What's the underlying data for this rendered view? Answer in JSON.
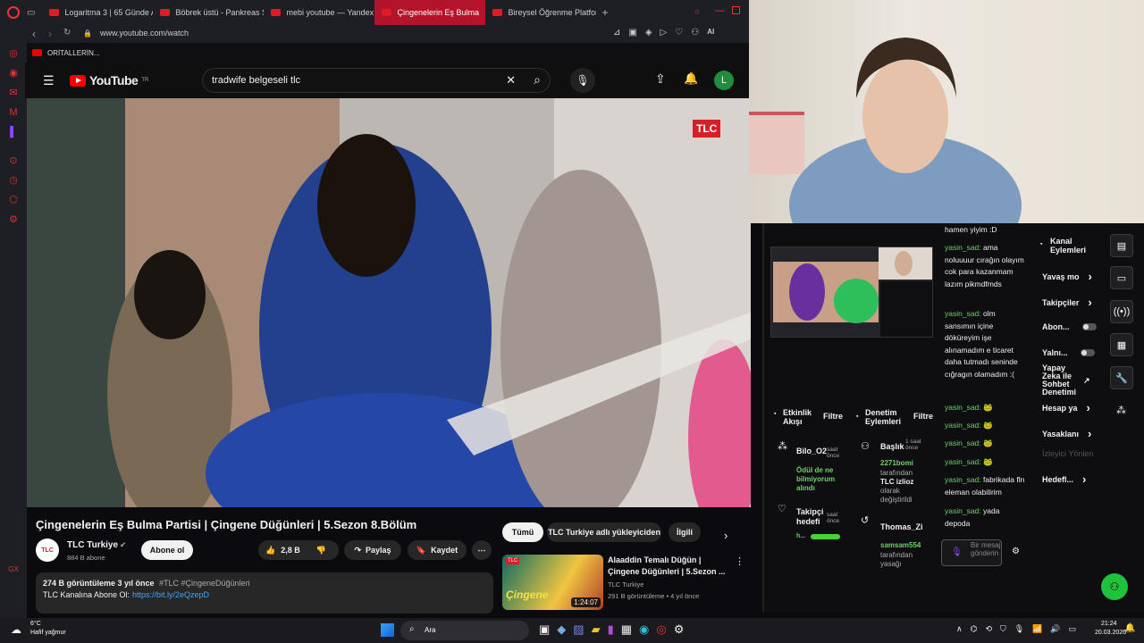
{
  "browser": {
    "tabs": [
      {
        "label": "Logaritma 3 | 65 Günde A",
        "active": false
      },
      {
        "label": "Böbrek üstü - Pankreas S",
        "active": false
      },
      {
        "label": "mebi youtube — Yandex",
        "active": false
      },
      {
        "label": "Çingenelerin Eş Bulma",
        "active": true
      },
      {
        "label": "Bireysel Öğrenme Platform",
        "active": false
      }
    ],
    "url": "www.youtube.com/watch",
    "bookmark": "ORİTALLERİN...",
    "ai_label": "AI"
  },
  "youtube": {
    "country": "TR",
    "logo_text": "YouTube",
    "search_value": "tradwife belgeseli tlc",
    "avatar_letter": "L",
    "video_watermark": "TLC",
    "video_title": "Çingenelerin Eş Bulma Partisi | Çingene Düğünleri | 5.Sezon 8.Bölüm",
    "channel": {
      "name": "TLC Turkiye",
      "subs": "884 B abone",
      "subscribe": "Abone ol",
      "logo": "TLC"
    },
    "likes": "2,8 B",
    "share": "Paylaş",
    "save": "Kaydet",
    "views": "274 B görüntüleme  3 yıl önce",
    "hashtags": "#TLC #ÇingeneDüğünleri",
    "desc_prefix": "TLC Kanalına Abone Ol:",
    "desc_link": "https://bit.ly/2eQzepD",
    "chips": [
      "Tümü",
      "TLC Turkiye adlı yükleyiciden",
      "İlgili"
    ],
    "rec": {
      "title_line1": "Alaaddin Temalı Düğün |",
      "title_line2": "Çingene Düğünleri | 5.Sezon ...",
      "channel": "TLC Turkiye",
      "meta": "291 B görüntüleme  •  4 yıl önce",
      "duration": "1:24:07",
      "thumb_text": "Çingene"
    }
  },
  "stream": {
    "activity_title": "Etkinlik Akışı",
    "filter": "Filtre",
    "activity": [
      {
        "name": "Bilo_O2",
        "time": "saat önce",
        "detail": "Ödül de ne bilmiyorum alındı"
      },
      {
        "name": "Takipçi hedefi",
        "time": "saat önce",
        "detail": "h..."
      }
    ],
    "mod_title": "Denetim Eylemleri",
    "mod_filter": "Filtre",
    "mod": [
      {
        "name": "Başlık",
        "time": "1 saat önce",
        "user": "2271bomi",
        "detail1": "tarafından",
        "detail2": "TLC izlioz",
        "detail3": "olarak değiştirildi"
      },
      {
        "name": "Thomas_Zi",
        "user": "samsam554",
        "detail1": "tarafından",
        "detail2": "yasağı"
      }
    ],
    "chat": [
      {
        "user": "",
        "text": "hamen yiyim :D"
      },
      {
        "user": "yasin_sad:",
        "text": " ama noluuuur cırağın olayım cok para kazanmam lazım pikmdfmds"
      },
      {
        "user": "yasin_sad:",
        "text": " olm sansımın içine döküreyim işe alınamadım e ticaret daha tutmadı seninde cığragın olamadım :("
      },
      {
        "user": "yasin_sad:",
        "text": " 🐸"
      },
      {
        "user": "yasin_sad:",
        "text": " 🐸"
      },
      {
        "user": "yasin_sad:",
        "text": " 🐸"
      },
      {
        "user": "yasin_sad:",
        "text": " 🐸"
      },
      {
        "user": "yasin_sad:",
        "text": " fabrikada fln eleman olabilirim"
      },
      {
        "user": "yasin_sad:",
        "text": " yada depoda"
      }
    ],
    "chat_placeholder": "Bir mesaj gönderin",
    "channel_actions_title": "Kanal Eylemleri",
    "channel_actions": [
      {
        "label": "Yavaş mo",
        "kind": "arrow"
      },
      {
        "label": "Takipçiler",
        "kind": "arrow"
      },
      {
        "label": "Abon...",
        "kind": "toggle"
      },
      {
        "label": "Yalnı...",
        "kind": "toggle"
      },
      {
        "label": "Yapay Zeka ile Sohbet Denetimi",
        "kind": "ext"
      },
      {
        "label": "Hesap ya",
        "kind": "arrow"
      },
      {
        "label": "Yasaklanı",
        "kind": "arrow"
      },
      {
        "label": "İzleyici Yönlen",
        "kind": "disabled"
      },
      {
        "label": "Hedefl...",
        "kind": "arrow"
      }
    ]
  },
  "taskbar": {
    "temp": "6°C",
    "weather": "Hafif yağmur",
    "search": "Ara",
    "time": "21:24",
    "date": "20.03.2026"
  }
}
